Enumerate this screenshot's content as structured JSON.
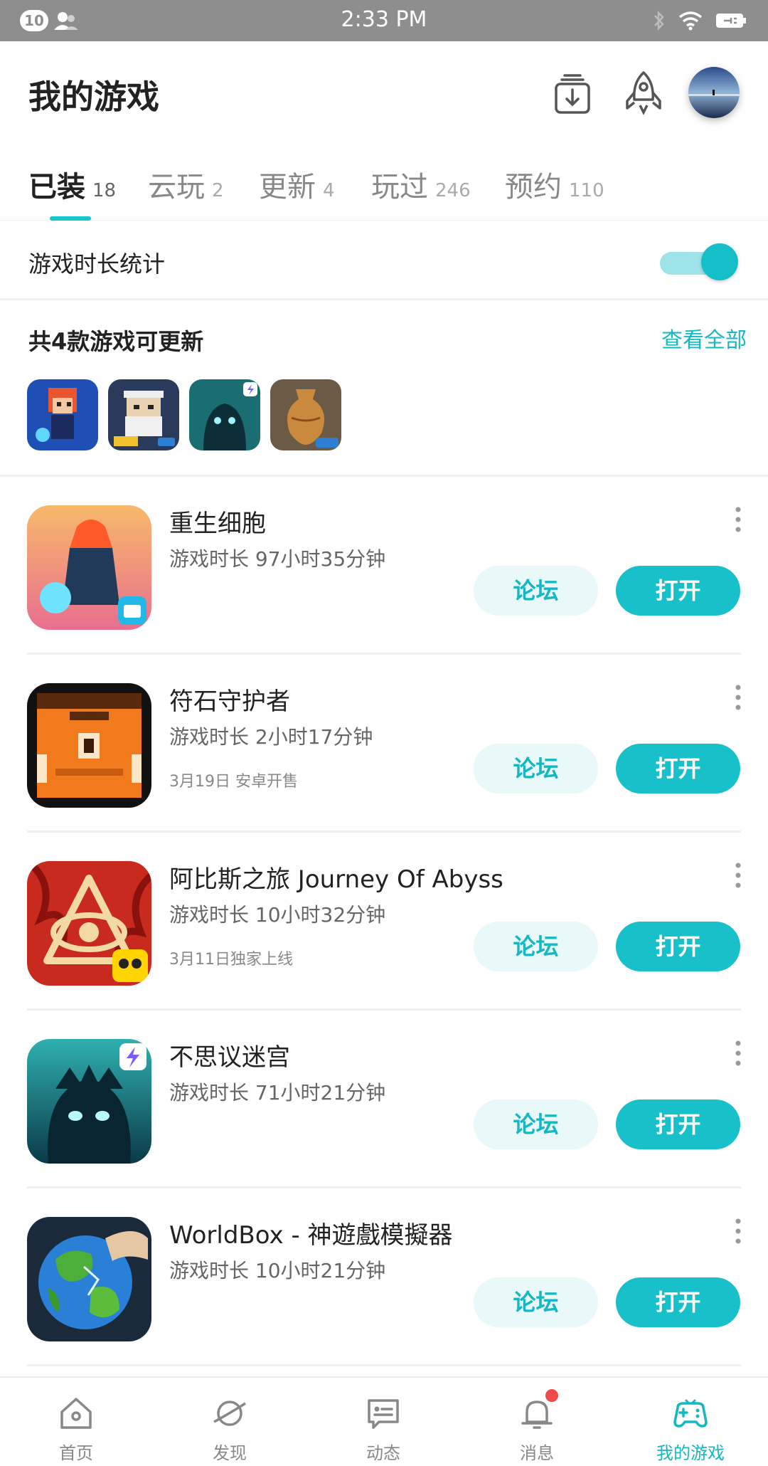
{
  "status_bar": {
    "notification_count": "10",
    "time": "2:33 PM",
    "icons": [
      "person-icon",
      "bluetooth-icon",
      "wifi-icon",
      "battery-icon"
    ]
  },
  "header": {
    "title": "我的游戏",
    "icons": [
      "download-manager-icon",
      "rocket-icon",
      "avatar"
    ]
  },
  "tabs": [
    {
      "label": "已装",
      "count": "18",
      "active": true
    },
    {
      "label": "云玩",
      "count": "2"
    },
    {
      "label": "更新",
      "count": "4"
    },
    {
      "label": "玩过",
      "count": "246"
    },
    {
      "label": "预约",
      "count": "110"
    }
  ],
  "stats": {
    "label": "游戏时长统计",
    "toggle_on": true
  },
  "updates": {
    "title": "共4款游戏可更新",
    "view_all": "查看全部",
    "icons": [
      "dead-cells-pixel-icon",
      "old-man-pixel-icon",
      "shadow-monster-icon",
      "pottery-vase-icon"
    ]
  },
  "games": [
    {
      "name": "重生细胞",
      "playtime": "游戏时长 97小时35分钟",
      "note": "",
      "forum": "论坛",
      "open": "打开",
      "icon": "dead-cells-icon"
    },
    {
      "name": "符石守护者",
      "playtime": "游戏时长 2小时17分钟",
      "note": "3月19日 安卓开售",
      "forum": "论坛",
      "open": "打开",
      "icon": "rune-guardian-icon"
    },
    {
      "name": "阿比斯之旅 Journey Of Abyss",
      "playtime": "游戏时长 10小时32分钟",
      "note": "3月11日独家上线",
      "forum": "论坛",
      "open": "打开",
      "icon": "journey-of-abyss-icon"
    },
    {
      "name": "不思议迷宫",
      "playtime": "游戏时长 71小时21分钟",
      "note": "",
      "forum": "论坛",
      "open": "打开",
      "icon": "mystery-maze-icon"
    },
    {
      "name": "WorldBox - 神遊戲模擬器",
      "playtime": "游戏时长 10小时21分钟",
      "note": "",
      "forum": "论坛",
      "open": "打开",
      "icon": "worldbox-icon"
    }
  ],
  "bottom_nav": [
    {
      "label": "首页",
      "icon": "home-icon"
    },
    {
      "label": "发现",
      "icon": "planet-icon"
    },
    {
      "label": "动态",
      "icon": "feed-icon"
    },
    {
      "label": "消息",
      "icon": "bell-icon",
      "badge": true
    },
    {
      "label": "我的游戏",
      "icon": "gamepad-icon",
      "active": true
    }
  ],
  "colors": {
    "accent": "#18c0c9",
    "accent_light": "#e9f8f9",
    "status_bar": "#8e8e8e",
    "badge_red": "#ef4a4a"
  }
}
